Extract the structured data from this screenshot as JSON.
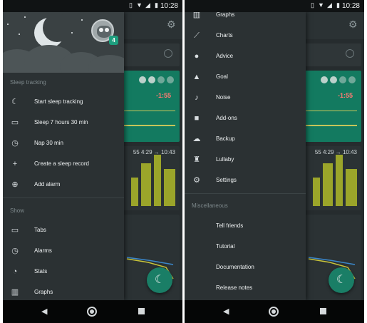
{
  "status_bar": {
    "time": "10:28",
    "icons": [
      "vibrate-icon",
      "wifi-icon",
      "signal-icon",
      "battery-icon"
    ]
  },
  "left": {
    "avatar_badge": "4",
    "section_sleep_tracking": "Sleep tracking",
    "sleep_items": [
      {
        "label": "Start sleep tracking",
        "icon": "moon-icon"
      },
      {
        "label": "Sleep 7 hours 30 min",
        "icon": "bed-icon"
      },
      {
        "label": "Nap 30 min",
        "icon": "alarm-clock-icon"
      },
      {
        "label": "Create a sleep record",
        "icon": "plus-icon"
      },
      {
        "label": "Add alarm",
        "icon": "add-alarm-icon"
      }
    ],
    "section_show": "Show",
    "show_items": [
      {
        "label": "Tabs",
        "icon": "tabs-icon"
      },
      {
        "label": "Alarms",
        "icon": "alarm-icon"
      },
      {
        "label": "Stats",
        "icon": "stats-icon"
      },
      {
        "label": "Graphs",
        "icon": "graphs-icon"
      }
    ],
    "bg_score": "-1:55",
    "bg_time_range": "55 4:29 → 10:43"
  },
  "right": {
    "menu_items": [
      {
        "label": "Graphs",
        "icon": "graphs-icon"
      },
      {
        "label": "Charts",
        "icon": "charts-icon"
      },
      {
        "label": "Advice",
        "icon": "lightbulb-icon"
      },
      {
        "label": "Goal",
        "icon": "mountain-icon"
      },
      {
        "label": "Noise",
        "icon": "microphone-icon"
      },
      {
        "label": "Add-ons",
        "icon": "puzzle-icon"
      },
      {
        "label": "Backup",
        "icon": "cloud-upload-icon"
      },
      {
        "label": "Lullaby",
        "icon": "lullaby-icon"
      },
      {
        "label": "Settings",
        "icon": "gear-icon"
      }
    ],
    "section_misc": "Miscellaneous",
    "misc_items": [
      {
        "label": "Tell friends"
      },
      {
        "label": "Tutorial"
      },
      {
        "label": "Documentation"
      },
      {
        "label": "Release notes"
      }
    ],
    "bg_score": "-1:55",
    "bg_time_range": "55 4:29 → 10:43"
  },
  "colors": {
    "accent": "#1e9e7e",
    "drawer_bg": "#2b3133",
    "green_card": "#137a60",
    "score_red": "#ff7a73"
  }
}
